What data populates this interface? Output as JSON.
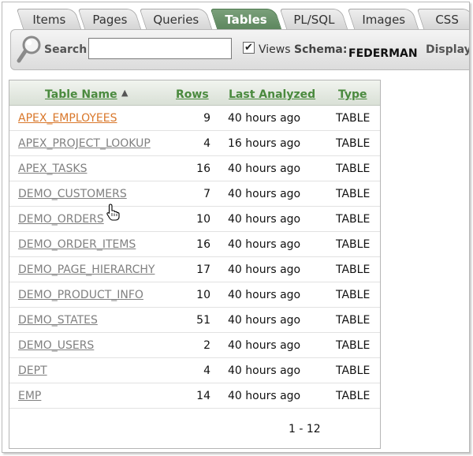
{
  "tabs": [
    {
      "label": "Items",
      "active": false
    },
    {
      "label": "Pages",
      "active": false
    },
    {
      "label": "Queries",
      "active": false
    },
    {
      "label": "Tables",
      "active": true
    },
    {
      "label": "PL/SQL",
      "active": false
    },
    {
      "label": "Images",
      "active": false
    },
    {
      "label": "CSS",
      "active": false
    }
  ],
  "search": {
    "label": "Search",
    "value": "",
    "views_checked": true,
    "views_label": "Views",
    "schema_label": "Schema:",
    "schema_value": "FEDERMAN",
    "display_label": "Display"
  },
  "table": {
    "columns": {
      "name": "Table Name",
      "rows": "Rows",
      "analyzed": "Last Analyzed",
      "type": "Type"
    },
    "sort_indicator": "▲",
    "rows": [
      {
        "name": "APEX_EMPLOYEES",
        "rows": "9",
        "analyzed": "40 hours ago",
        "type": "TABLE"
      },
      {
        "name": "APEX_PROJECT_LOOKUP",
        "rows": "4",
        "analyzed": "16 hours ago",
        "type": "TABLE"
      },
      {
        "name": "APEX_TASKS",
        "rows": "16",
        "analyzed": "40 hours ago",
        "type": "TABLE"
      },
      {
        "name": "DEMO_CUSTOMERS",
        "rows": "7",
        "analyzed": "40 hours ago",
        "type": "TABLE"
      },
      {
        "name": "DEMO_ORDERS",
        "rows": "10",
        "analyzed": "40 hours ago",
        "type": "TABLE"
      },
      {
        "name": "DEMO_ORDER_ITEMS",
        "rows": "16",
        "analyzed": "40 hours ago",
        "type": "TABLE"
      },
      {
        "name": "DEMO_PAGE_HIERARCHY",
        "rows": "17",
        "analyzed": "40 hours ago",
        "type": "TABLE"
      },
      {
        "name": "DEMO_PRODUCT_INFO",
        "rows": "10",
        "analyzed": "40 hours ago",
        "type": "TABLE"
      },
      {
        "name": "DEMO_STATES",
        "rows": "51",
        "analyzed": "40 hours ago",
        "type": "TABLE"
      },
      {
        "name": "DEMO_USERS",
        "rows": "2",
        "analyzed": "40 hours ago",
        "type": "TABLE"
      },
      {
        "name": "DEPT",
        "rows": "4",
        "analyzed": "40 hours ago",
        "type": "TABLE"
      },
      {
        "name": "EMP",
        "rows": "14",
        "analyzed": "40 hours ago",
        "type": "TABLE"
      }
    ],
    "pagination": "1 - 12"
  },
  "colors": {
    "active_tab": "#6a936b",
    "header_link": "#4a8a3e",
    "row_link": "#808080",
    "hover_link": "#d9772a"
  },
  "icons": [
    "magnifier-icon",
    "hand-pointer-icon",
    "sort-ascending-icon",
    "checkbox-checked-icon"
  ]
}
